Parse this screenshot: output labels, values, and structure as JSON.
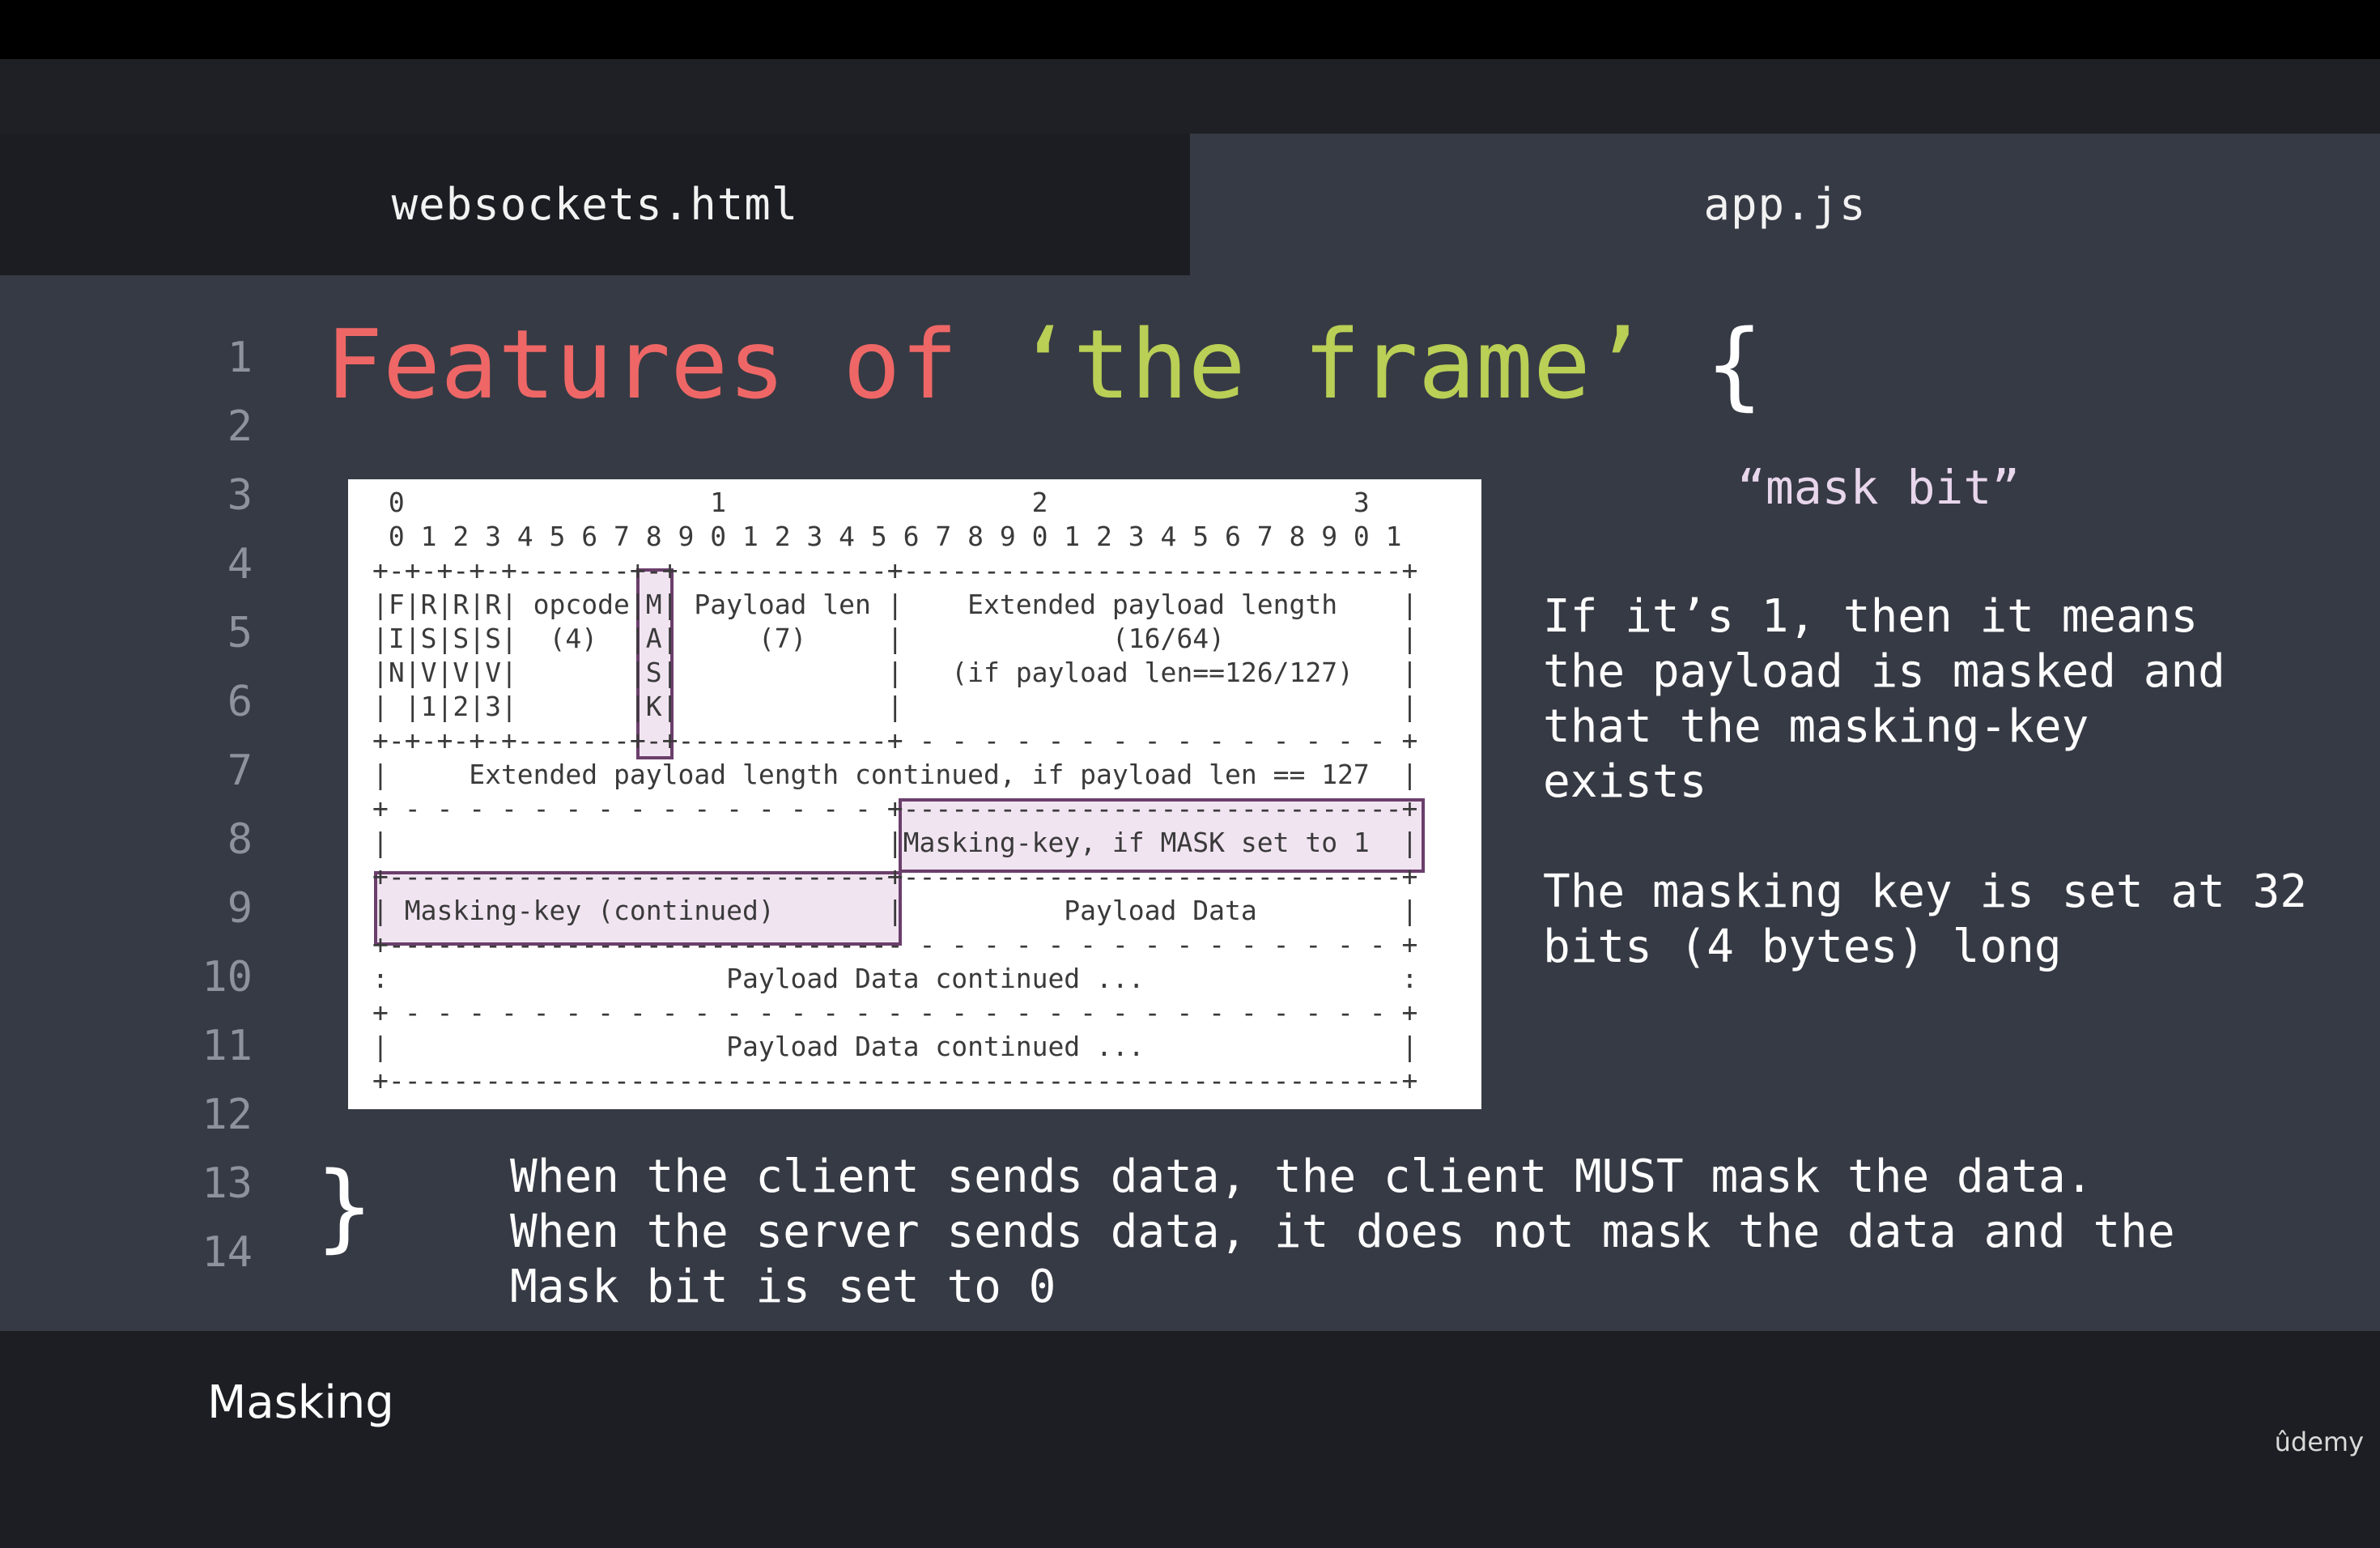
{
  "tabs": [
    {
      "label": "websockets.html"
    },
    {
      "label": "app.js"
    }
  ],
  "line_numbers": [
    "1",
    "2",
    "3",
    "4",
    "5",
    "6",
    "7",
    "8",
    "9",
    "10",
    "11",
    "12",
    "13",
    "14"
  ],
  "title": {
    "part1": "Features of ",
    "part2": "‘the frame’",
    "brace_open": " {",
    "brace_close": "}"
  },
  "diagram": {
    "lines": [
      " 0                   1                   2                   3",
      " 0 1 2 3 4 5 6 7 8 9 0 1 2 3 4 5 6 7 8 9 0 1 2 3 4 5 6 7 8 9 0 1",
      "+-+-+-+-+-------+-+-------------+-------------------------------+",
      "|F|R|R|R| opcode|M| Payload len |    Extended payload length    |",
      "|I|S|S|S|  (4)  |A|     (7)     |             (16/64)           |",
      "|N|V|V|V|       |S|             |   (if payload len==126/127)   |",
      "| |1|2|3|       |K|             |                               |",
      "+-+-+-+-+-------+-+-------------+ - - - - - - - - - - - - - - - +",
      "|     Extended payload length continued, if payload len == 127  |",
      "+ - - - - - - - - - - - - - - - +-------------------------------+",
      "|                               |Masking-key, if MASK set to 1  |",
      "+-------------------------------+-------------------------------+",
      "| Masking-key (continued)       |          Payload Data         |",
      "+-------------------------------- - - - - - - - - - - - - - - - +",
      ":                     Payload Data continued ...                :",
      "+ - - - - - - - - - - - - - - - - - - - - - - - - - - - - - - - +",
      "|                     Payload Data continued ...                |",
      "+---------------------------------------------------------------+"
    ]
  },
  "side": {
    "quote": "“mask bit”",
    "para1": "If it’s 1, then it means\nthe payload is masked and\nthat the masking-key\nexists",
    "para2": "The masking key is set at 32\nbits (4 bytes) long"
  },
  "bottom_note": "When the client sends data, the client MUST mask the data.\nWhen the server sends data, it does not mask the data and the\nMask bit is set to 0",
  "caption": "Masking",
  "logo": "ûdemy"
}
